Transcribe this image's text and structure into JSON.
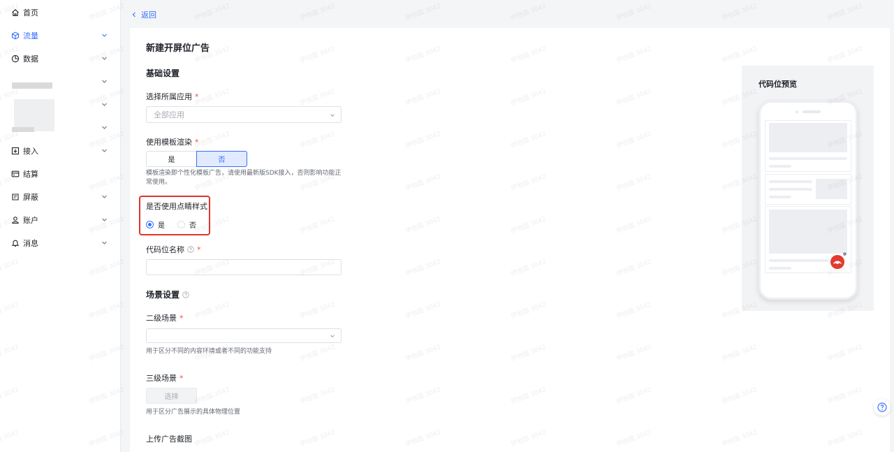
{
  "sidebar": {
    "items": [
      {
        "label": "首页",
        "icon": "home-icon"
      },
      {
        "label": "流量",
        "icon": "cube-icon"
      },
      {
        "label": "数据",
        "icon": "pie-chart-icon"
      },
      {
        "label": "接入",
        "icon": "import-icon"
      },
      {
        "label": "结算",
        "icon": "wallet-icon"
      },
      {
        "label": "屏蔽",
        "icon": "shield-list-icon"
      },
      {
        "label": "账户",
        "icon": "user-icon"
      },
      {
        "label": "消息",
        "icon": "bell-icon"
      }
    ],
    "accent": "#3370ff"
  },
  "header": {
    "back_label": "返回"
  },
  "form": {
    "title": "新建开屏位广告",
    "basic_section": "基础设置",
    "app_label": "选择所属应用",
    "app_placeholder": "全部应用",
    "template_label": "使用模板渲染",
    "template_options": [
      "是",
      "否"
    ],
    "template_selected": "否",
    "template_hint": "模板渲染即个性化模板广告，请使用最新版SDK接入，否则影响功能正常使用。",
    "eye_label": "是否使用点睛样式",
    "eye_options": [
      "是",
      "否"
    ],
    "eye_selected": "是",
    "slot_name_label": "代码位名称",
    "scene_section": "场景设置",
    "scene2_label": "二级场景",
    "scene2_hint": "用于区分不同的内容环境或者不同的功能支持",
    "scene3_label": "三级场景",
    "scene3_button": "选择",
    "scene3_hint": "用于区分广告展示的具体物理位置",
    "upload_label": "上传广告截图",
    "required_mark": "*"
  },
  "preview": {
    "title": "代码位预览"
  },
  "watermark": "伊他国 3042",
  "colors": {
    "highlight": "#e0342b",
    "ad_red": "#e23b2f"
  }
}
